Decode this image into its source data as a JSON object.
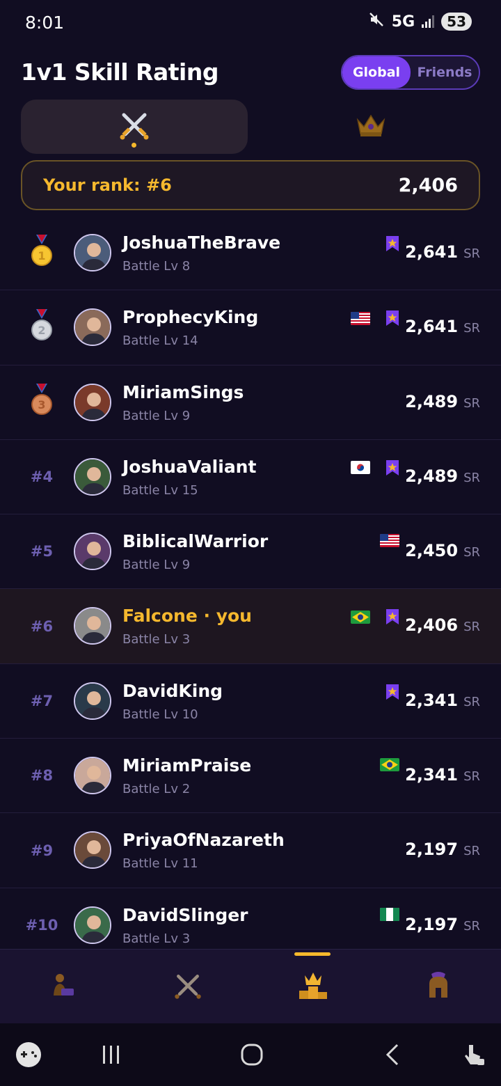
{
  "status_bar": {
    "time": "8:01",
    "network": "5G",
    "battery": "53"
  },
  "header": {
    "title": "1v1 Skill Rating"
  },
  "scope_toggle": {
    "global_label": "Global",
    "friends_label": "Friends",
    "selected": "Global"
  },
  "mode_tabs": [
    {
      "icon": "crossed-swords-icon",
      "selected": true
    },
    {
      "icon": "crown-icon",
      "selected": false
    }
  ],
  "your_rank": {
    "label": "Your rank: #6",
    "value": "2,406"
  },
  "score_unit": "SR",
  "players": [
    {
      "rank": "1",
      "medal": "gold",
      "name": "JoshuaTheBrave",
      "level": "Battle Lv 8",
      "flag": null,
      "badge": true,
      "score": "2,641"
    },
    {
      "rank": "2",
      "medal": "silver",
      "name": "ProphecyKing",
      "level": "Battle Lv 14",
      "flag": "us",
      "badge": true,
      "score": "2,641"
    },
    {
      "rank": "3",
      "medal": "bronze",
      "name": "MiriamSings",
      "level": "Battle Lv 9",
      "flag": null,
      "badge": false,
      "score": "2,489"
    },
    {
      "rank": "#4",
      "medal": null,
      "name": "JoshuaValiant",
      "level": "Battle Lv 15",
      "flag": "kr",
      "badge": true,
      "score": "2,489"
    },
    {
      "rank": "#5",
      "medal": null,
      "name": "BiblicalWarrior",
      "level": "Battle Lv 9",
      "flag": "us",
      "badge": false,
      "score": "2,450"
    },
    {
      "rank": "#6",
      "medal": null,
      "name": "Falcone · you",
      "level": "Battle Lv 3",
      "flag": "br",
      "badge": true,
      "score": "2,406",
      "me": true
    },
    {
      "rank": "#7",
      "medal": null,
      "name": "DavidKing",
      "level": "Battle Lv 10",
      "flag": null,
      "badge": true,
      "score": "2,341"
    },
    {
      "rank": "#8",
      "medal": null,
      "name": "MiriamPraise",
      "level": "Battle Lv 2",
      "flag": "br",
      "badge": false,
      "score": "2,341"
    },
    {
      "rank": "#9",
      "medal": null,
      "name": "PriyaOfNazareth",
      "level": "Battle Lv 11",
      "flag": null,
      "badge": false,
      "score": "2,197"
    },
    {
      "rank": "#10",
      "medal": null,
      "name": "DavidSlinger",
      "level": "Battle Lv 3",
      "flag": "ng",
      "badge": false,
      "score": "2,197"
    }
  ],
  "bottom_nav": [
    {
      "icon": "reading-person-icon",
      "active": false
    },
    {
      "icon": "crossed-swords-icon",
      "active": false
    },
    {
      "icon": "crown-podium-icon",
      "active": true
    },
    {
      "icon": "spartan-helmet-icon",
      "active": false
    }
  ],
  "colors": {
    "background": "#110d22",
    "accent_purple": "#7a3ff0",
    "accent_gold": "#f5b82e",
    "muted_text": "#8a84a6"
  }
}
